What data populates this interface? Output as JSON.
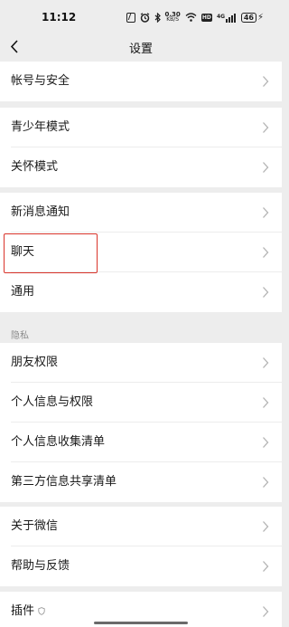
{
  "status_bar": {
    "time": "11:12",
    "net_speed_value": "0.30",
    "net_speed_unit": "KB/S",
    "hd_label": "HD",
    "signal_label": "4G",
    "battery": "46"
  },
  "nav": {
    "title": "设置"
  },
  "menu": {
    "account_security": "帐号与安全",
    "teen_mode": "青少年模式",
    "care_mode": "关怀模式",
    "new_message_notify": "新消息通知",
    "chat": "聊天",
    "general": "通用",
    "privacy_header": "隐私",
    "friend_permissions": "朋友权限",
    "personal_info_permissions": "个人信息与权限",
    "personal_info_collection": "个人信息收集清单",
    "third_party_sharing": "第三方信息共享清单",
    "about_wechat": "关于微信",
    "help_feedback": "帮助与反馈",
    "plugins": "插件"
  },
  "colors": {
    "background": "#ededed",
    "row": "#ffffff",
    "highlight": "#d9342b"
  }
}
